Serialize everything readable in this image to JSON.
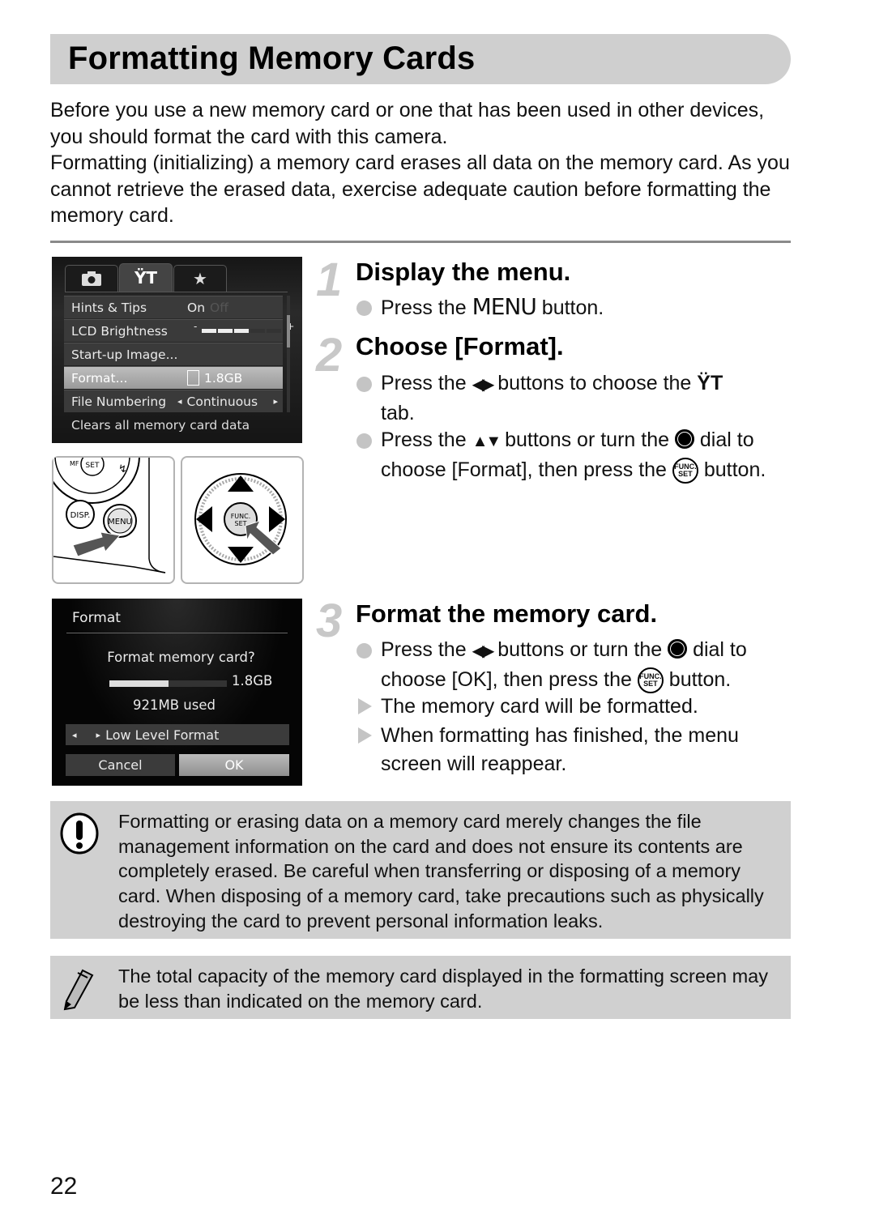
{
  "page": {
    "title": "Formatting Memory Cards",
    "intro": [
      "Before you use a new memory card or one that has been used in other devices, you should format the card with this camera.",
      "Formatting (initializing) a memory card erases all data on the memory card. As you cannot retrieve the erased data, exercise adequate caution before formatting the memory card."
    ],
    "page_number": "22"
  },
  "menu_screen": {
    "tabs": [
      {
        "icon": "camera-icon",
        "glyph": "●",
        "active": false
      },
      {
        "icon": "wrench-hammer-icon",
        "glyph": "ΫT",
        "active": true
      },
      {
        "icon": "star-icon",
        "glyph": "★",
        "active": false
      }
    ],
    "rows": [
      {
        "label": "Hints & Tips",
        "value": "On",
        "value_dim": "Off",
        "selected": false
      },
      {
        "label": "LCD Brightness",
        "value": "",
        "brightness_level": 3,
        "brightness_max": 5,
        "minus": "-",
        "plus": "+",
        "selected": false
      },
      {
        "label": "Start-up Image...",
        "value": "",
        "selected": false
      },
      {
        "label": "Format...",
        "value": "1.8GB",
        "selected": true
      },
      {
        "label": "File Numbering",
        "value": "Continuous",
        "left_arrow": "◂",
        "right_arrow": "▸",
        "selected": false
      }
    ],
    "hint": "Clears all memory card data"
  },
  "illustrations": {
    "left": {
      "buttons": [
        "DISP.",
        "MENU",
        "SET",
        "MF"
      ]
    },
    "right": {
      "center": "FUNC. SET"
    }
  },
  "format_screen": {
    "title": "Format",
    "question": "Format memory card?",
    "capacity": "1.8GB",
    "used_fraction": 0.5,
    "used_text": "921MB used",
    "low_level": {
      "left_arrow": "◂",
      "check_arrow": "▸",
      "label": "Low Level Format"
    },
    "buttons": {
      "cancel": "Cancel",
      "ok": "OK"
    }
  },
  "steps": [
    {
      "number": "1",
      "title": "Display the menu.",
      "bullets": [
        {
          "type": "action",
          "parts": [
            "Press the ",
            "MENU",
            " button."
          ]
        }
      ]
    },
    {
      "number": "2",
      "title": "Choose [Format].",
      "bullets": [
        {
          "type": "action",
          "parts": [
            "Press the ",
            "◀▶",
            " buttons to choose the ",
            "ΫT",
            " tab."
          ]
        },
        {
          "type": "action",
          "parts": [
            "Press the ",
            "▲▼",
            " buttons or turn the ",
            " dial to choose [Format], then press the ",
            " button."
          ]
        }
      ]
    },
    {
      "number": "3",
      "title": "Format the memory card.",
      "bullets": [
        {
          "type": "action",
          "parts": [
            "Press the ",
            "◀▶",
            " buttons or turn the ",
            " dial to choose [OK], then press the ",
            " button."
          ]
        },
        {
          "type": "result",
          "text": "The memory card will be formatted."
        },
        {
          "type": "result",
          "text": "When formatting has finished, the menu screen will reappear."
        }
      ]
    }
  ],
  "func_label": {
    "top": "FUNC.",
    "bottom": "SET"
  },
  "notes": {
    "caution": "Formatting or erasing data on a memory card merely changes the file management information on the card and does not ensure its contents are completely erased. Be careful when transferring or disposing of a memory card. When disposing of a memory card, take precautions such as physically destroying the card to prevent personal information leaks.",
    "tip": "The total capacity of the memory card displayed in the formatting screen may be less than indicated on the memory card."
  }
}
